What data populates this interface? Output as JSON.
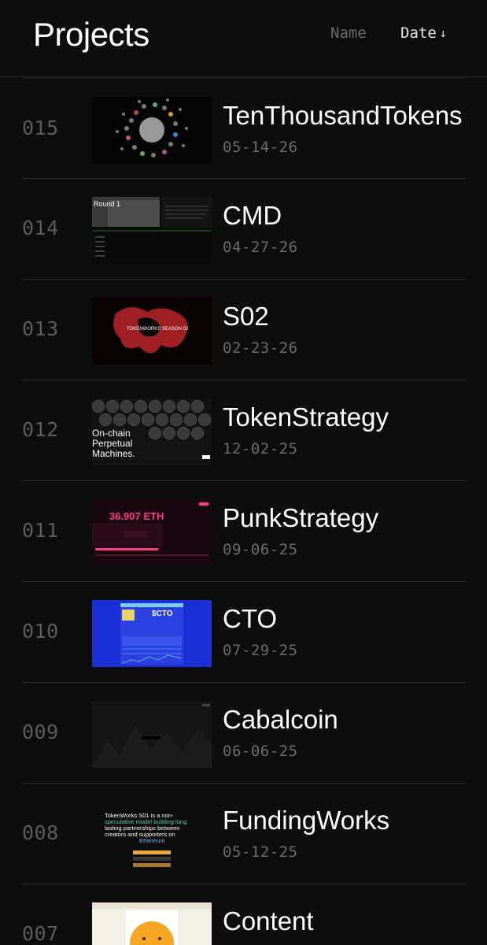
{
  "header": {
    "title": "Projects",
    "sort_name_label": "Name",
    "sort_date_label": "Date",
    "sort_direction_icon": "arrow-down-icon"
  },
  "projects": [
    {
      "number": "015",
      "title": "TenThousandTokens",
      "date": "05-14-26"
    },
    {
      "number": "014",
      "title": "CMD",
      "date": "04-27-26",
      "thumb_text": "Round 1"
    },
    {
      "number": "013",
      "title": "S02",
      "date": "02-23-26",
      "thumb_text": "TOKENWORKS SEASON 02"
    },
    {
      "number": "012",
      "title": "TokenStrategy",
      "date": "12-02-25",
      "thumb_text": [
        "On-chain",
        "Perpetual",
        "Machines."
      ]
    },
    {
      "number": "011",
      "title": "PunkStrategy",
      "date": "09-06-25",
      "thumb_text": "36.907 ETH"
    },
    {
      "number": "010",
      "title": "CTO",
      "date": "07-29-25",
      "thumb_text": "$CTO"
    },
    {
      "number": "009",
      "title": "Cabalcoin",
      "date": "06-06-25"
    },
    {
      "number": "008",
      "title": "FundingWorks",
      "date": "05-12-25",
      "thumb_text": [
        "TokenWorks S01 is a non-",
        "speculative model building long",
        "lasting partnerships between",
        "creators and supporters on",
        "Ethereum"
      ]
    },
    {
      "number": "007",
      "title": "Content",
      "date": ""
    }
  ],
  "colors": {
    "background": "#0d0d0d",
    "divider": "#2a2a2a",
    "muted_text": "#6b6b6b",
    "number_text": "#5c5c5c",
    "cto_blue": "#1a2fd6",
    "punk_pink": "#ff3b8b",
    "s02_red": "#d0302f"
  }
}
